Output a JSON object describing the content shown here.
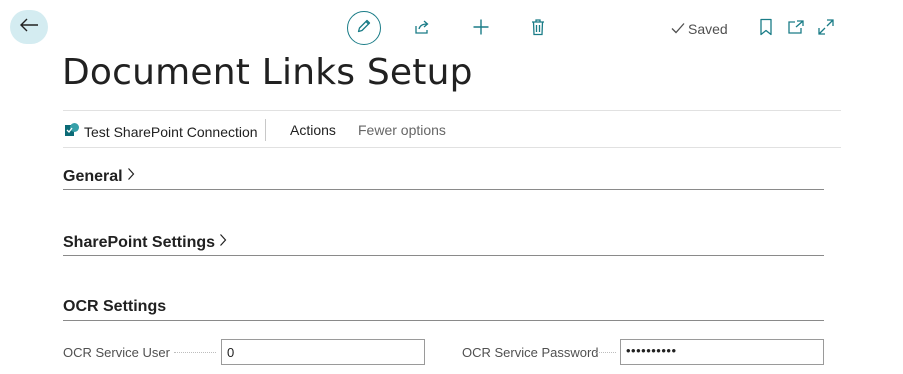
{
  "header": {
    "title": "Document Links Setup",
    "status": "Saved"
  },
  "toolbar": {
    "icons": [
      "back-arrow-icon",
      "pencil-icon",
      "share-icon",
      "plus-icon",
      "trash-icon",
      "bookmark-icon",
      "open-new-window-icon",
      "expand-icon"
    ]
  },
  "actions": {
    "test_connection": "Test SharePoint Connection",
    "actions": "Actions",
    "fewer_options": "Fewer options"
  },
  "sections": {
    "general": "General",
    "sharepoint": "SharePoint Settings",
    "ocr": "OCR Settings"
  },
  "ocr": {
    "user_label": "OCR Service User",
    "user_value": "0",
    "password_label": "OCR Service Password",
    "password_value": "••••••••••"
  },
  "colors": {
    "accent": "#1a7c87",
    "back_button_bg": "#d4ecf1",
    "icon_blue": "#1a7c87"
  }
}
